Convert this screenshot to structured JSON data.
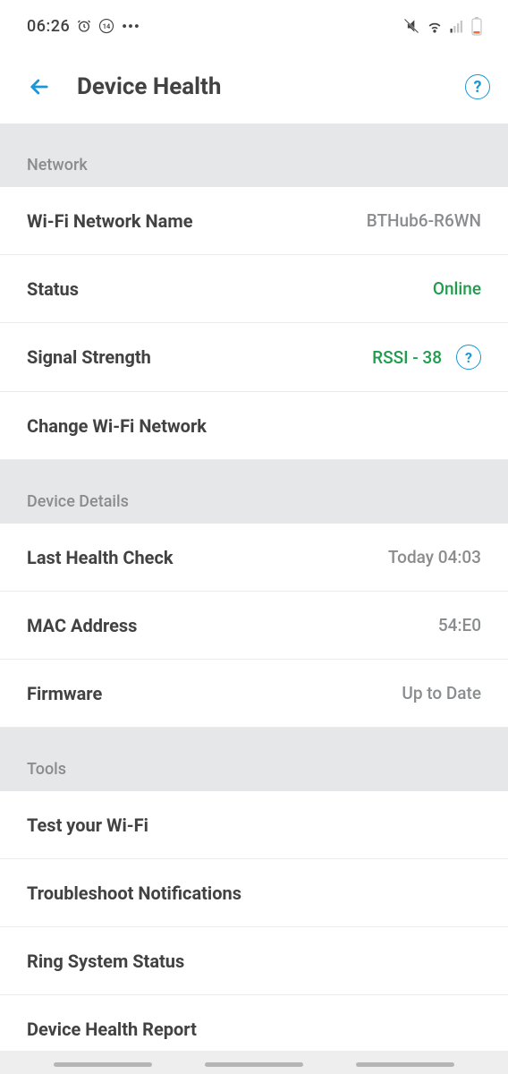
{
  "statusbar": {
    "time": "06:26",
    "notification_count": "14"
  },
  "header": {
    "title": "Device Health"
  },
  "sections": {
    "network": {
      "header": "Network",
      "wifi_name_label": "Wi-Fi Network Name",
      "wifi_name_value": "BTHub6-R6WN",
      "status_label": "Status",
      "status_value": "Online",
      "signal_label": "Signal Strength",
      "signal_value": "RSSI - 38",
      "change_wifi_label": "Change Wi-Fi Network"
    },
    "device": {
      "header": "Device Details",
      "last_check_label": "Last Health Check",
      "last_check_value": "Today 04:03",
      "mac_label": "MAC Address",
      "mac_value": "54:E0",
      "firmware_label": "Firmware",
      "firmware_value": "Up to Date"
    },
    "tools": {
      "header": "Tools",
      "test_wifi": "Test your Wi-Fi",
      "troubleshoot": "Troubleshoot Notifications",
      "system_status": "Ring System Status",
      "health_report": "Device Health Report"
    }
  }
}
